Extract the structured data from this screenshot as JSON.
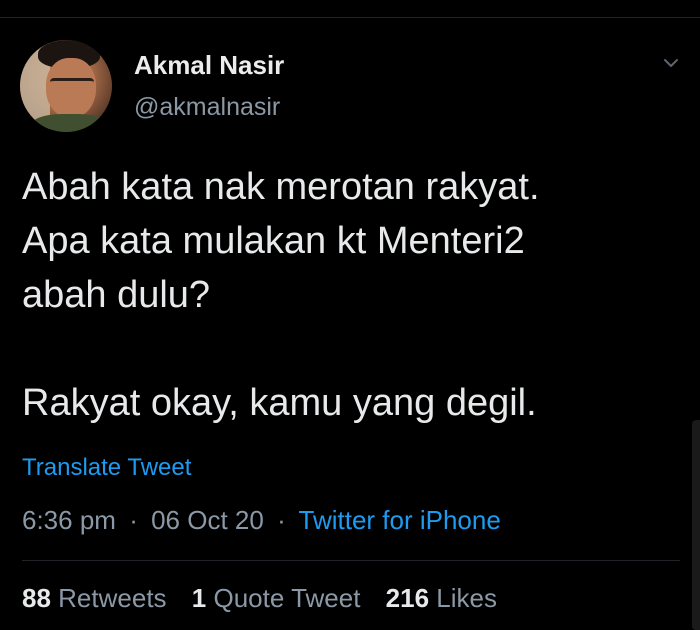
{
  "author": {
    "name": "Akmal Nasir",
    "handle": "@akmalnasir",
    "avatar_icon": "profile-photo"
  },
  "tweet": {
    "lines": [
      "Abah kata nak merotan rakyat.",
      "Apa kata mulakan kt Menteri2",
      "abah dulu?",
      "",
      "Rakyat okay, kamu yang degil."
    ],
    "translate_label": "Translate Tweet"
  },
  "meta": {
    "time": "6:36 pm",
    "separator": "·",
    "date": "06 Oct 20",
    "source": "Twitter for iPhone"
  },
  "stats": {
    "retweets_count": "88",
    "retweets_label": "Retweets",
    "quotes_count": "1",
    "quotes_label": "Quote Tweet",
    "likes_count": "216",
    "likes_label": "Likes"
  },
  "icons": {
    "more": "chevron-down-icon"
  },
  "colors": {
    "background": "#000000",
    "text": "#e7e9ea",
    "secondary": "#8b98a5",
    "link": "#1d9bf0"
  }
}
